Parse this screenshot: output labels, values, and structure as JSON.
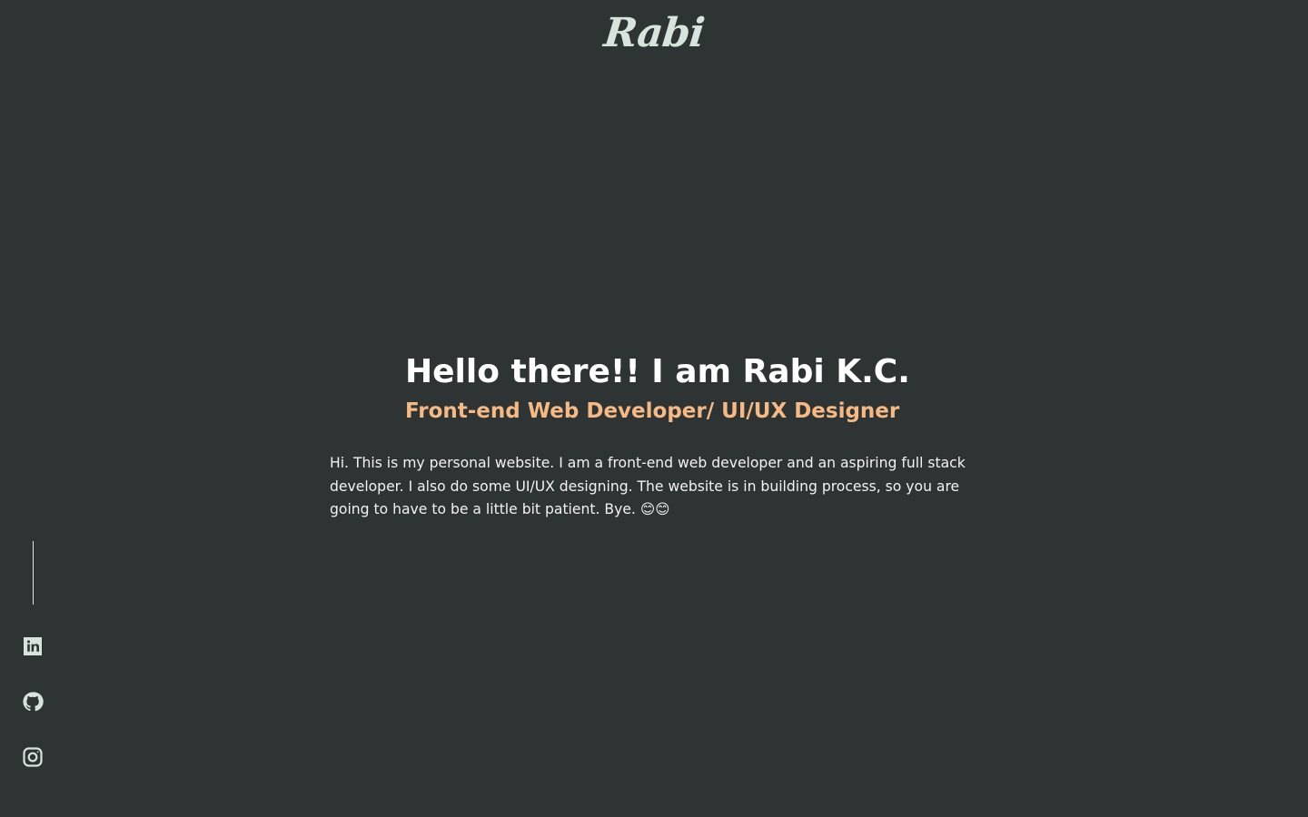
{
  "header": {
    "logo_text": "Rabi"
  },
  "hero": {
    "title": "Hello there!! I am Rabi K.C.",
    "subtitle": "Front-end Web Developer/ UI/UX Designer",
    "intro": "Hi. This is my personal website. I am a front-end web developer and an aspiring full stack developer. I also do some UI/UX designing. The website is in building process, so you are going to have to be a little bit patient. Bye. 😊😊"
  },
  "social": {
    "items": [
      {
        "icon": "linkedin-icon"
      },
      {
        "icon": "github-icon"
      },
      {
        "icon": "instagram-icon"
      }
    ]
  },
  "colors": {
    "background": "#2d3433",
    "accent": "#f6b984",
    "logo": "#d6e4dc",
    "text": "#ffffff"
  }
}
